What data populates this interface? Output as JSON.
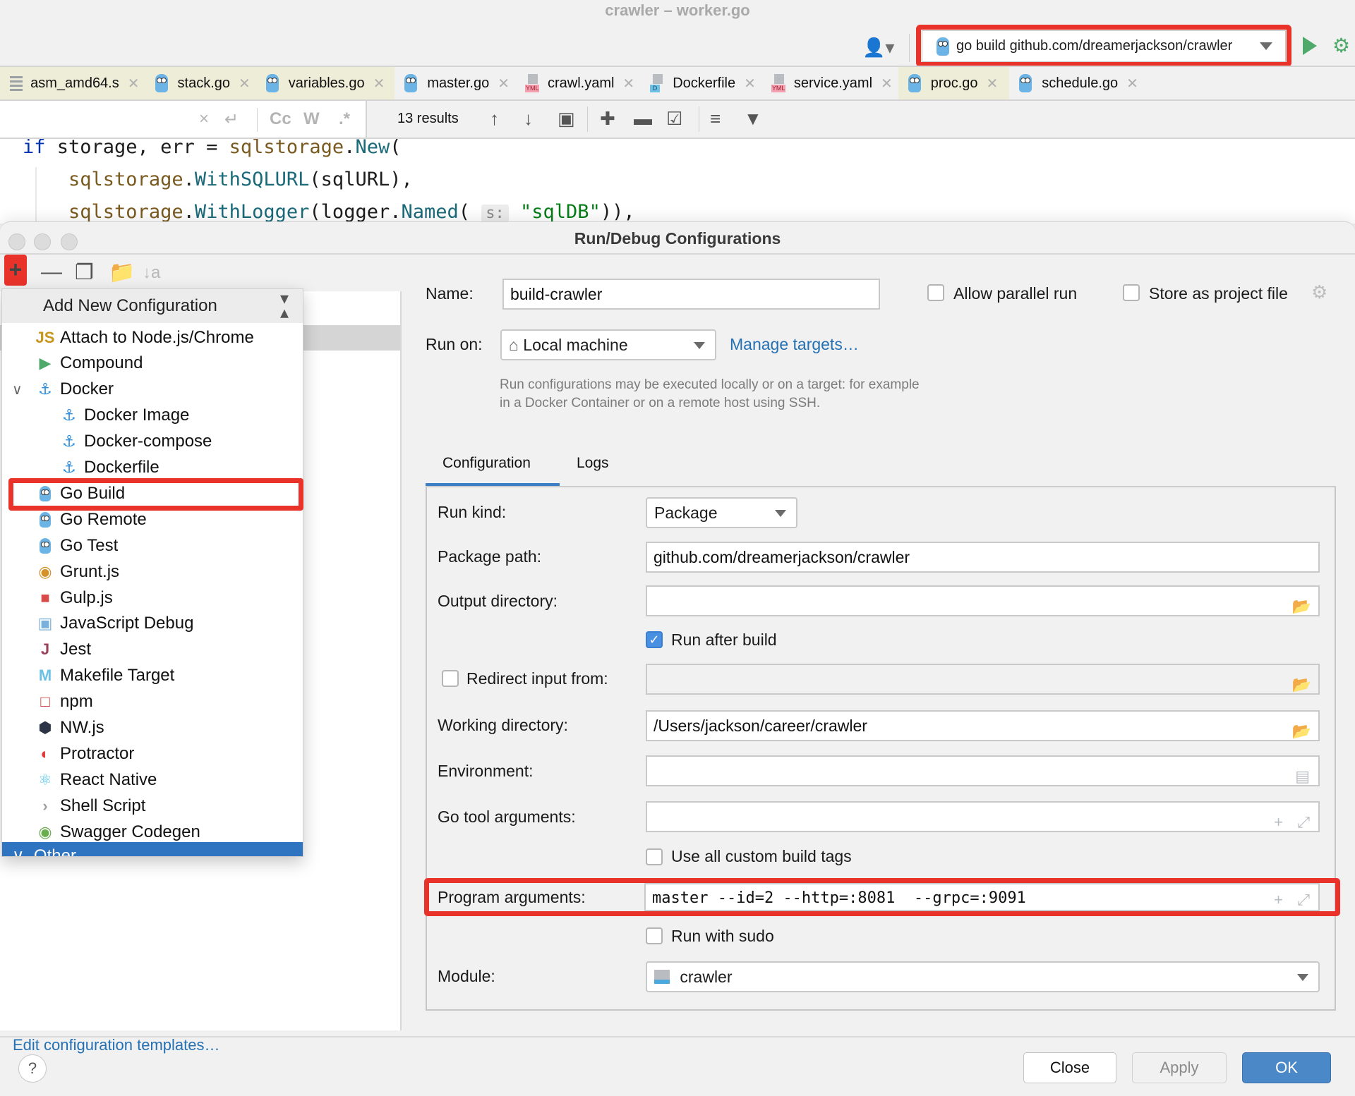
{
  "window": {
    "title": "crawler – worker.go"
  },
  "toolbar": {
    "user_icon": "user-dropdown-icon",
    "run_config_label": "go build github.com/dreamerjackson/crawler",
    "run_icon": "play-icon",
    "debug_icon": "bug-icon"
  },
  "tabs": [
    {
      "label": "asm_amd64.s",
      "icon": "asm-file-icon",
      "highlighted": true
    },
    {
      "label": "stack.go",
      "icon": "go-file-icon",
      "highlighted": true
    },
    {
      "label": "variables.go",
      "icon": "go-file-icon",
      "highlighted": true
    },
    {
      "label": "master.go",
      "icon": "go-file-icon",
      "highlighted": false
    },
    {
      "label": "crawl.yaml",
      "icon": "yaml-file-icon",
      "highlighted": false
    },
    {
      "label": "Dockerfile",
      "icon": "dockerfile-icon",
      "highlighted": false
    },
    {
      "label": "service.yaml",
      "icon": "yaml-file-icon",
      "highlighted": false
    },
    {
      "label": "proc.go",
      "icon": "go-file-icon",
      "highlighted": true
    },
    {
      "label": "schedule.go",
      "icon": "go-file-icon",
      "highlighted": false
    }
  ],
  "findbar": {
    "search_value": "",
    "options": [
      "Cc",
      "W",
      ".*"
    ],
    "results": "13 results"
  },
  "editor": {
    "lines": [
      "if storage, err = sqlstorage.New(",
      "    sqlstorage.WithSQLURL(sqlURL),",
      "    sqlstorage.WithLogger(logger.Named( s: \"sqlDB\")),"
    ],
    "param_hint": "s:"
  },
  "dialog": {
    "title": "Run/Debug Configurations",
    "left_toolbar": [
      "add-icon",
      "remove-icon",
      "copy-icon",
      "new-folder-icon",
      "sort-icon"
    ],
    "edit_templates_link": "Edit configuration templates…",
    "buttons": {
      "close": "Close",
      "apply": "Apply",
      "ok": "OK"
    },
    "help": "?"
  },
  "popup": {
    "title": "Add New Configuration",
    "items": [
      {
        "label": "Attach to Node.js/Chrome",
        "icon": "nodejs-attach-icon",
        "level": 0
      },
      {
        "label": "Compound",
        "icon": "compound-icon",
        "level": 0
      },
      {
        "label": "Docker",
        "icon": "docker-icon",
        "level": 0,
        "expanded": true
      },
      {
        "label": "Docker Image",
        "icon": "docker-icon",
        "level": 1
      },
      {
        "label": "Docker-compose",
        "icon": "docker-icon",
        "level": 1
      },
      {
        "label": "Dockerfile",
        "icon": "docker-icon",
        "level": 1
      },
      {
        "label": "Go Build",
        "icon": "go-build-icon",
        "level": 0,
        "highlighted": true
      },
      {
        "label": "Go Remote",
        "icon": "go-remote-icon",
        "level": 0
      },
      {
        "label": "Go Test",
        "icon": "go-test-icon",
        "level": 0
      },
      {
        "label": "Grunt.js",
        "icon": "grunt-icon",
        "level": 0
      },
      {
        "label": "Gulp.js",
        "icon": "gulp-icon",
        "level": 0
      },
      {
        "label": "JavaScript Debug",
        "icon": "js-debug-icon",
        "level": 0
      },
      {
        "label": "Jest",
        "icon": "jest-icon",
        "level": 0
      },
      {
        "label": "Makefile Target",
        "icon": "makefile-icon",
        "level": 0
      },
      {
        "label": "npm",
        "icon": "npm-icon",
        "level": 0
      },
      {
        "label": "NW.js",
        "icon": "nwjs-icon",
        "level": 0
      },
      {
        "label": "Protractor",
        "icon": "protractor-icon",
        "level": 0
      },
      {
        "label": "React Native",
        "icon": "react-icon",
        "level": 0
      },
      {
        "label": "Shell Script",
        "icon": "shell-icon",
        "level": 0
      },
      {
        "label": "Swagger Codegen",
        "icon": "swagger-icon",
        "level": 0
      }
    ],
    "selected_group": "Other"
  },
  "form": {
    "name_label": "Name:",
    "name_value": "build-crawler",
    "allow_parallel_label": "Allow parallel run",
    "allow_parallel": false,
    "store_project_label": "Store as project file",
    "store_project": false,
    "run_on_label": "Run on:",
    "run_on_value": "Local machine",
    "manage_targets": "Manage targets…",
    "run_on_hint": "Run configurations may be executed locally or on a target: for example in a Docker Container or on a remote host using SSH.",
    "tabs": [
      "Configuration",
      "Logs"
    ],
    "active_tab": "Configuration",
    "run_kind_label": "Run kind:",
    "run_kind_value": "Package",
    "package_path_label": "Package path:",
    "package_path_value": "github.com/dreamerjackson/crawler",
    "output_dir_label": "Output directory:",
    "output_dir_value": "",
    "run_after_build_label": "Run after build",
    "run_after_build": true,
    "redirect_input_label": "Redirect input from:",
    "redirect_input": false,
    "redirect_input_value": "",
    "working_dir_label": "Working directory:",
    "working_dir_value": "/Users/jackson/career/crawler",
    "environment_label": "Environment:",
    "environment_value": "",
    "go_tool_args_label": "Go tool arguments:",
    "go_tool_args_value": "",
    "custom_tags_label": "Use all custom build tags",
    "custom_tags": false,
    "program_args_label": "Program arguments:",
    "program_args_value": "master --id=2 --http=:8081  --grpc=:9091",
    "run_sudo_label": "Run with sudo",
    "run_sudo": false,
    "module_label": "Module:",
    "module_value": "crawler"
  },
  "colors": {
    "annotation_red": "#e8322a",
    "accent_blue": "#4a88c7",
    "link_blue": "#2470b3",
    "run_green": "#4fa96a"
  }
}
